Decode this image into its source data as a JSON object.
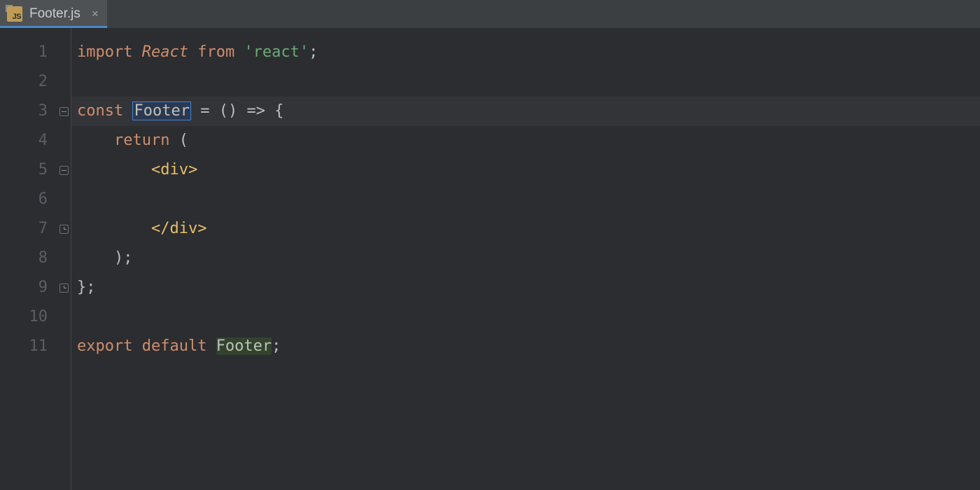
{
  "tab": {
    "icon": "js-file-icon",
    "title": "Footer.js",
    "close": "×"
  },
  "gutter": [
    "1",
    "2",
    "3",
    "4",
    "5",
    "6",
    "7",
    "8",
    "9",
    "10",
    "11"
  ],
  "fold": [
    "",
    "",
    "minus",
    "",
    "minus",
    "",
    "end",
    "",
    "end",
    "",
    ""
  ],
  "caretLineIndex": 2,
  "tokens": [
    [
      [
        "import ",
        "kw"
      ],
      [
        "React",
        "kw-i"
      ],
      [
        " ",
        ""
      ],
      [
        "from ",
        "kw"
      ],
      [
        "'react'",
        "str"
      ],
      [
        ";",
        "punc"
      ]
    ],
    [],
    [
      [
        "const ",
        "kw"
      ],
      [
        "Footer",
        "id sel-box"
      ],
      [
        " = () => {",
        "punc"
      ]
    ],
    [
      [
        "    ",
        ""
      ],
      [
        "return ",
        "kw"
      ],
      [
        "(",
        "punc"
      ]
    ],
    [
      [
        "        ",
        ""
      ],
      [
        "<",
        "tag-br"
      ],
      [
        "div",
        "tag-nm"
      ],
      [
        ">",
        "tag-br"
      ]
    ],
    [],
    [
      [
        "        ",
        ""
      ],
      [
        "</",
        "tag-br"
      ],
      [
        "div",
        "tag-nm"
      ],
      [
        ">",
        "tag-br"
      ]
    ],
    [
      [
        "    ",
        ""
      ],
      [
        ");",
        "punc"
      ]
    ],
    [
      [
        "};",
        "punc"
      ]
    ],
    [],
    [
      [
        "export ",
        "kw"
      ],
      [
        "default ",
        "kw"
      ],
      [
        "Footer",
        "id hl-usage"
      ],
      [
        ";",
        "punc"
      ]
    ]
  ]
}
